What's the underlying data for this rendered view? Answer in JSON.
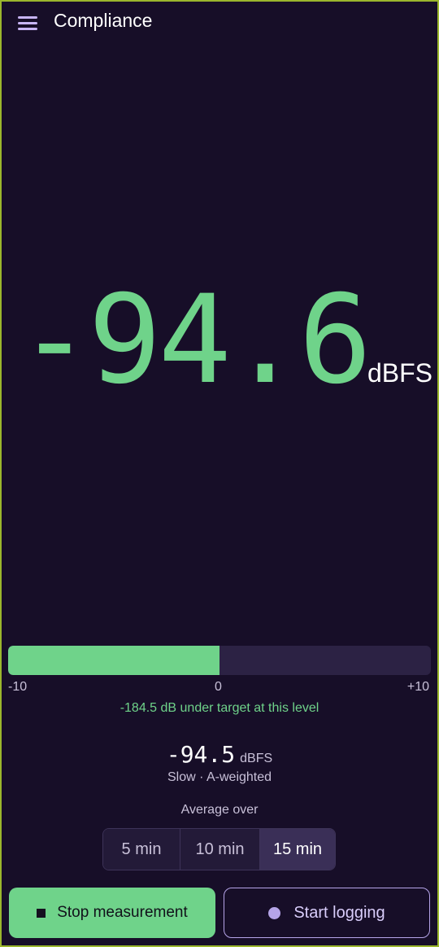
{
  "app_bar": {
    "title": "Compliance",
    "menu_icon": "menu-icon"
  },
  "reading": {
    "value": "-94.6",
    "unit": "dBFS"
  },
  "meter": {
    "min_label": "-10",
    "mid_label": "0",
    "max_label": "+10",
    "level_fraction": 0.5,
    "status_text": "-184.5 dB under target at this level",
    "fill_color": "#6fd38a"
  },
  "average": {
    "value": "-94.5",
    "unit": "dBFS",
    "mode": "Slow · A-weighted",
    "over_label": "Average over",
    "options": [
      "5 min",
      "10 min",
      "15 min"
    ],
    "selected": "15 min"
  },
  "actions": {
    "stop_label": "Stop measurement",
    "stop_icon": "stop-icon",
    "log_label": "Start logging",
    "log_icon": "record-dot-icon"
  },
  "colors": {
    "accent_green": "#6fd38a",
    "accent_purple": "#b5a4e8",
    "background": "#170e28"
  }
}
